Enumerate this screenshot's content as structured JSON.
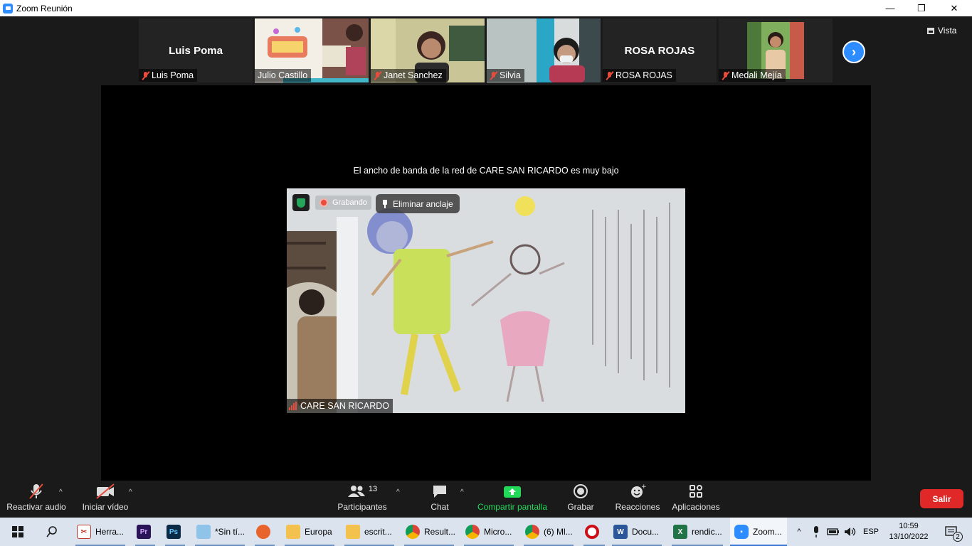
{
  "window": {
    "title": "Zoom Reunión",
    "minimize_glyph": "—",
    "restore_glyph": "❐",
    "close_glyph": "✕"
  },
  "view_button": "Vista",
  "participants_strip": [
    {
      "big_name": "Luis Poma",
      "label": "Luis Poma"
    },
    {
      "big_name": "",
      "label": "Julio Castillo"
    },
    {
      "big_name": "",
      "label": "Janet Sanchez"
    },
    {
      "big_name": "",
      "label": "Silvia"
    },
    {
      "big_name": "ROSA ROJAS",
      "label": "ROSA ROJAS"
    },
    {
      "big_name": "",
      "label": "Medali Mejía"
    }
  ],
  "bandwidth_message": "El ancho de banda de la red de CARE SAN RICARDO es muy bajo",
  "active_video": {
    "recording_label": "Grabando",
    "unpin_label": "Eliminar anclaje",
    "name": "CARE SAN RICARDO"
  },
  "toolbar": {
    "audio": "Reactivar audio",
    "video": "Iniciar vídeo",
    "participants": "Participantes",
    "participants_count": "13",
    "chat": "Chat",
    "share": "Compartir pantalla",
    "record": "Grabar",
    "reactions": "Reacciones",
    "apps": "Aplicaciones",
    "leave": "Salir"
  },
  "taskbar": {
    "apps": [
      {
        "label": "Herra...",
        "icon": "snipping-tool-icon",
        "color": "#c0392b"
      },
      {
        "label": "",
        "icon": "premiere-icon",
        "color": "#2a1357"
      },
      {
        "label": "",
        "icon": "photoshop-icon",
        "color": "#0b2a45"
      },
      {
        "label": "*Sin tí...",
        "icon": "notepad-icon",
        "color": "#4a90c2"
      },
      {
        "label": "",
        "icon": "firefox-icon",
        "color": "#e8642c"
      },
      {
        "label": "Europa",
        "icon": "folder-icon",
        "color": "#f2c14e"
      },
      {
        "label": "escrit...",
        "icon": "folder-icon",
        "color": "#f2c14e"
      },
      {
        "label": "Result...",
        "icon": "chrome-icon",
        "color": "#db4437"
      },
      {
        "label": "Micro...",
        "icon": "chrome-icon",
        "color": "#db4437"
      },
      {
        "label": "(6) Ml...",
        "icon": "chrome-icon",
        "color": "#db4437"
      },
      {
        "label": "",
        "icon": "opera-icon",
        "color": "#cc0f16"
      },
      {
        "label": "Docu...",
        "icon": "word-icon",
        "color": "#2b579a"
      },
      {
        "label": "rendic...",
        "icon": "excel-icon",
        "color": "#217346"
      },
      {
        "label": "Zoom...",
        "icon": "zoom-icon",
        "color": "#2d8cff"
      }
    ],
    "language": "ESP",
    "time": "10:59",
    "date": "13/10/2022",
    "notification_count": "2"
  },
  "colors": {
    "accent": "#2d8cff",
    "leave": "#e02828",
    "share": "#23d959",
    "muted": "#e74c3c"
  }
}
